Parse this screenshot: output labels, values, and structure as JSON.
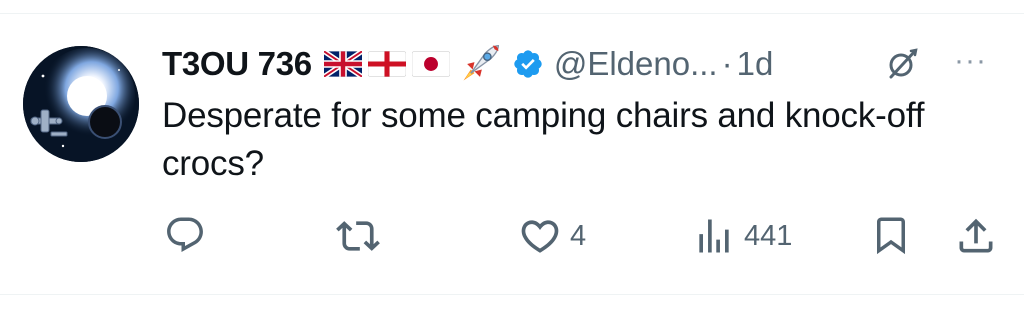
{
  "tweet": {
    "author": {
      "display_name": "T3OU 736",
      "handle": "@Eldeno...",
      "separator": "·",
      "timestamp": "1d"
    },
    "flags": [
      "uk-flag",
      "england-flag",
      "japan-flag",
      "rocket-emoji"
    ],
    "verified": true,
    "text": "Desperate for some camping chairs and knock-off crocs?",
    "actions": {
      "reply": {
        "icon": "reply-icon"
      },
      "retweet": {
        "icon": "retweet-icon"
      },
      "like": {
        "icon": "heart-icon",
        "count": "4"
      },
      "views": {
        "icon": "views-icon",
        "count": "441"
      },
      "bookmark": {
        "icon": "bookmark-icon"
      },
      "share": {
        "icon": "share-icon"
      }
    },
    "more_label": "···"
  },
  "colors": {
    "text": "#0f1419",
    "secondary": "#536471",
    "verified": "#1d9bf0",
    "divider": "#eff3f4"
  }
}
